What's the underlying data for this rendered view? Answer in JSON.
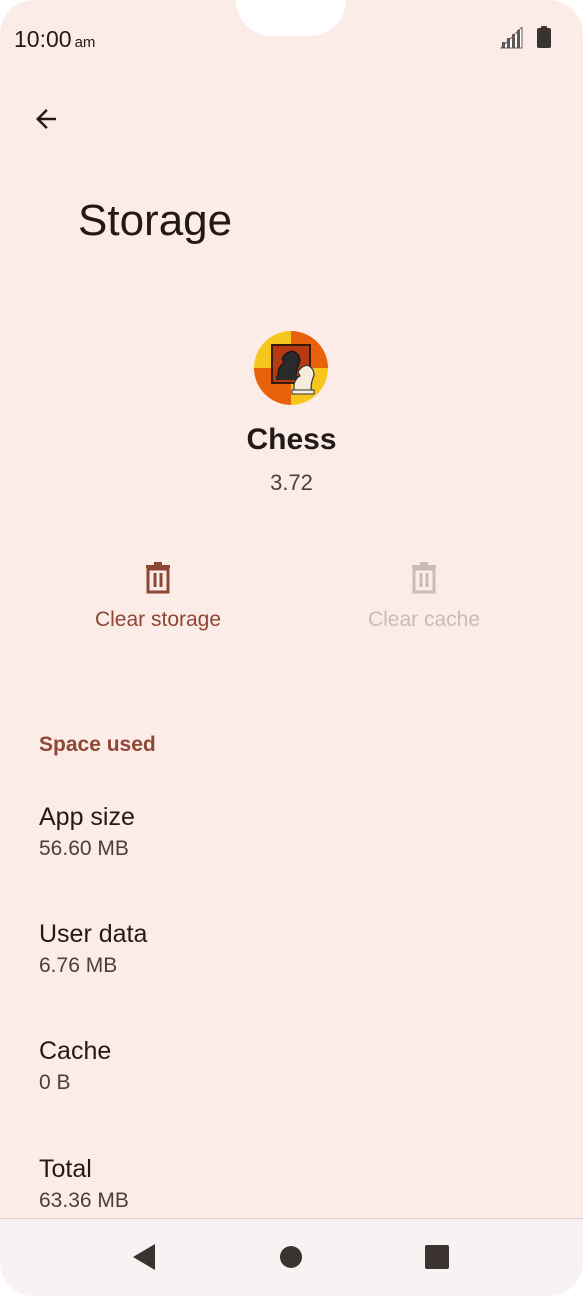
{
  "status_bar": {
    "time": "10:00",
    "ampm": "am",
    "signal_icon": "cell-signal-icon",
    "battery_icon": "battery-full-icon"
  },
  "header": {
    "back_icon": "arrow-back-icon",
    "title": "Storage"
  },
  "app": {
    "icon": "chess-knight-app-icon",
    "name": "Chess",
    "version": "3.72"
  },
  "actions": {
    "clear_storage": {
      "label": "Clear storage",
      "icon": "trash-icon",
      "enabled": true
    },
    "clear_cache": {
      "label": "Clear cache",
      "icon": "trash-icon",
      "enabled": false
    }
  },
  "space_used": {
    "header": "Space used",
    "rows": [
      {
        "title": "App size",
        "value": "56.60 MB"
      },
      {
        "title": "User data",
        "value": "6.76 MB"
      },
      {
        "title": "Cache",
        "value": "0 B"
      },
      {
        "title": "Total",
        "value": "63.36 MB"
      }
    ]
  },
  "nav_bar": {
    "back_icon": "nav-back-triangle-icon",
    "home_icon": "nav-home-circle-icon",
    "recents_icon": "nav-recents-square-icon"
  },
  "colors": {
    "background": "#fbece8",
    "accent": "#8f4634",
    "disabled": "#c9bcb8",
    "text_primary": "#231a18",
    "text_secondary": "#4b3f3c"
  }
}
